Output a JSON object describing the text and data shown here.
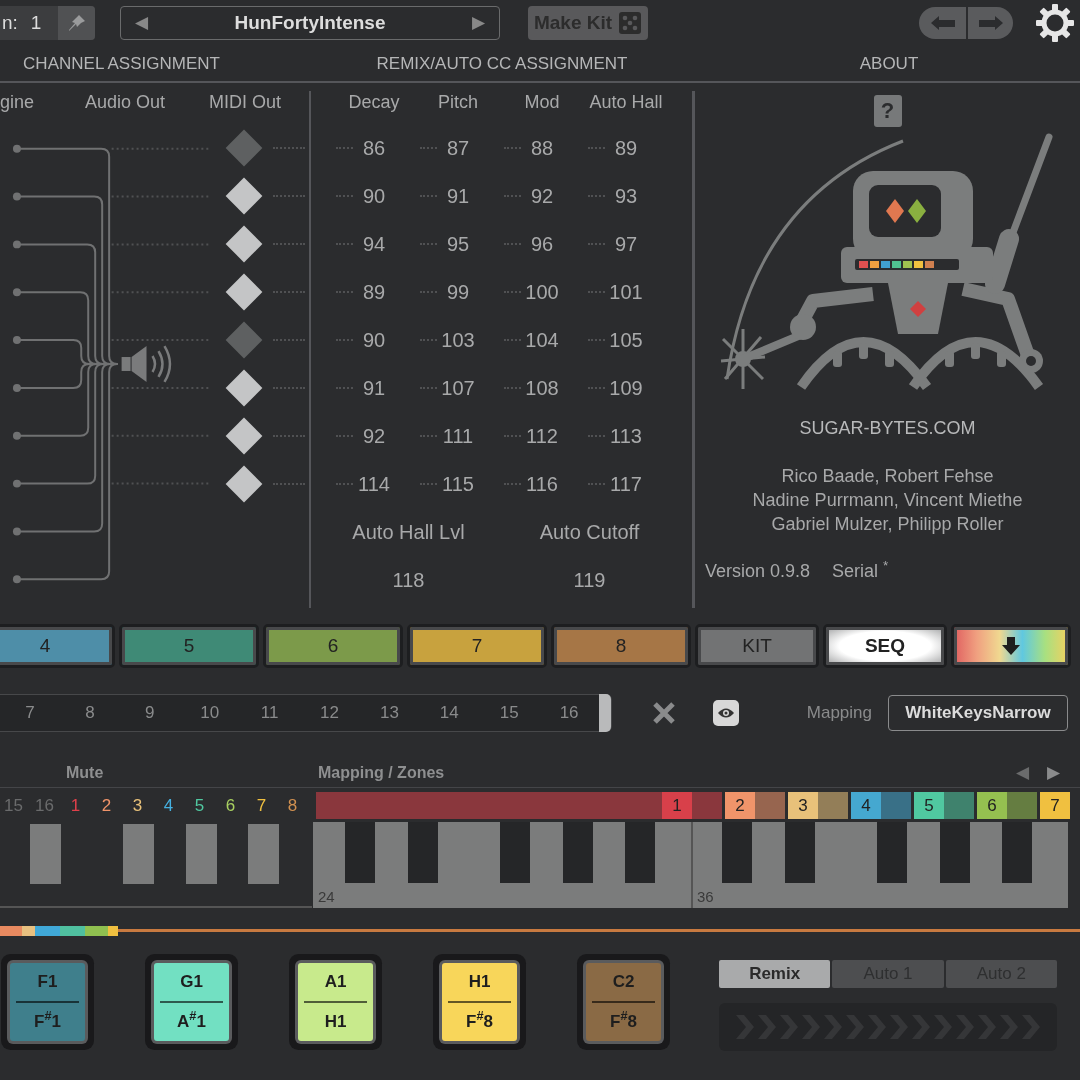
{
  "top_bar": {
    "channel_label": "n:",
    "channel_value": "1",
    "preset_prev": "◀",
    "preset": "HunFortyIntense",
    "preset_next": "▶",
    "make_kit": "Make Kit"
  },
  "section_headers": [
    "CHANNEL ASSIGNMENT",
    "REMIX/AUTO CC ASSIGNMENT",
    "ABOUT"
  ],
  "channel_assignment": {
    "columns": [
      "gine",
      "Audio Out",
      "MIDI Out"
    ],
    "midi_out": [
      {
        "on": false
      },
      {
        "on": true
      },
      {
        "on": true
      },
      {
        "on": true
      },
      {
        "on": false
      },
      {
        "on": true
      },
      {
        "on": true
      },
      {
        "on": true
      }
    ]
  },
  "cc_assignment": {
    "columns": [
      "Decay",
      "Pitch",
      "Mod",
      "Auto Hall"
    ],
    "rows": [
      [
        "86",
        "87",
        "88",
        "89"
      ],
      [
        "90",
        "91",
        "92",
        "93"
      ],
      [
        "94",
        "95",
        "96",
        "97"
      ],
      [
        "89",
        "99",
        "100",
        "101"
      ],
      [
        "90",
        "103",
        "104",
        "105"
      ],
      [
        "91",
        "107",
        "108",
        "109"
      ],
      [
        "92",
        "111",
        "112",
        "113"
      ],
      [
        "114",
        "115",
        "116",
        "117"
      ]
    ],
    "extra_columns": [
      "Auto Hall Lvl",
      "Auto Cutoff"
    ],
    "extra_values": [
      "118",
      "119"
    ]
  },
  "about": {
    "help": "?",
    "website": "SUGAR-BYTES.COM",
    "credits": [
      "Rico Baade, Robert Fehse",
      "Nadine Purrmann, Vincent Miethe",
      "Gabriel Mulzer, Philipp Roller"
    ],
    "version": "Version 0.9.8",
    "serial": "Serial $^{*}$"
  },
  "channel_buttons": [
    {
      "kind": "channel",
      "label": "4",
      "color": "#4e8ea8"
    },
    {
      "kind": "channel",
      "label": "5",
      "color": "#3f8a76"
    },
    {
      "kind": "channel",
      "label": "6",
      "color": "#7c9a4a"
    },
    {
      "kind": "channel",
      "label": "7",
      "color": "#c8a23e"
    },
    {
      "kind": "channel",
      "label": "8",
      "color": "#a67646"
    },
    {
      "kind": "kit",
      "label": "KIT"
    },
    {
      "kind": "seq",
      "label": "SEQ"
    },
    {
      "kind": "rainbow"
    }
  ],
  "steps": [
    "7",
    "8",
    "9",
    "10",
    "11",
    "12",
    "13",
    "14",
    "15",
    "16"
  ],
  "mapping": {
    "label": "Mapping",
    "value": "WhiteKeysNarrow"
  },
  "zones_header": {
    "mute": "Mute",
    "title": "Mapping / Zones",
    "prev": "◀",
    "next": "▶"
  },
  "mute_channels": [
    {
      "label": "15",
      "color": "#6a6b6c"
    },
    {
      "label": "16",
      "color": "#6a6b6c"
    },
    {
      "label": "1",
      "color": "#e0404a"
    },
    {
      "label": "2",
      "color": "#f0946a"
    },
    {
      "label": "3",
      "color": "#e8c17a"
    },
    {
      "label": "4",
      "color": "#45b0e0"
    },
    {
      "label": "5",
      "color": "#50c8a0"
    },
    {
      "label": "6",
      "color": "#a8d060"
    },
    {
      "label": "7",
      "color": "#f0c040"
    },
    {
      "label": "8",
      "color": "#d09050"
    }
  ],
  "zones": [
    {
      "label": "1",
      "color": "#d8404a"
    },
    {
      "label": "2",
      "color": "#f0946a"
    },
    {
      "label": "3",
      "color": "#e8c17a"
    },
    {
      "label": "4",
      "color": "#45a8d0"
    },
    {
      "label": "5",
      "color": "#50c8a0"
    },
    {
      "label": "6",
      "color": "#95c050"
    },
    {
      "label": "7",
      "color": "#f0c040"
    }
  ],
  "keyboard": {
    "octave_labels": [
      "24",
      "36"
    ]
  },
  "pads": [
    {
      "top": "F1",
      "bottom": "F$^{#}$1",
      "color": "#3f7f8c"
    },
    {
      "top": "G1",
      "bottom": "A$^{#}$1",
      "color": "#72e0c2"
    },
    {
      "top": "A1",
      "bottom": "H1",
      "color": "#c8ea8c"
    },
    {
      "top": "H1",
      "bottom": "F$^{#}$8",
      "color": "#f8d65a"
    },
    {
      "top": "C2",
      "bottom": "F$^{#}$8",
      "color": "#8a6a45"
    }
  ],
  "remix_tabs": [
    {
      "label": "Remix",
      "selected": true
    },
    {
      "label": "Auto 1",
      "selected": false
    },
    {
      "label": "Auto 2",
      "selected": false
    }
  ]
}
